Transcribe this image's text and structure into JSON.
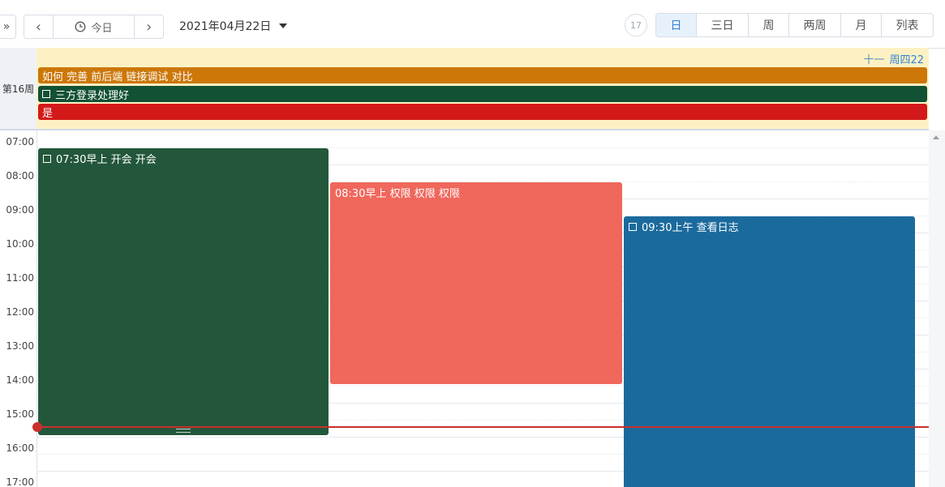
{
  "toolbar": {
    "expand_label": "»",
    "prev_label": "‹",
    "today_label": "今日",
    "next_label": "›",
    "date_label": "2021年04月22日",
    "day_number": "17",
    "views": [
      "日",
      "三日",
      "周",
      "两周",
      "月",
      "列表"
    ],
    "active_view": "日"
  },
  "allday": {
    "week_label": "第16周",
    "lunar": "十一",
    "weekday_date": "周四22",
    "events": [
      {
        "title": "如何 完善 前后端 链接调试 对比",
        "color": "#cc7708",
        "checkbox": false
      },
      {
        "title": "三方登录处理好",
        "color": "#125134",
        "checkbox": true
      },
      {
        "title": "是",
        "color": "#d31919",
        "checkbox": false
      }
    ]
  },
  "timegrid": {
    "hours": [
      "07:00",
      "08:00",
      "09:00",
      "10:00",
      "11:00",
      "12:00",
      "13:00",
      "14:00",
      "15:00",
      "16:00",
      "17:00"
    ],
    "events": [
      {
        "title": "07:30早上 开会 开会",
        "color": "#23573b",
        "checkbox": true
      },
      {
        "title": "08:30早上 权限 权限 权限",
        "color": "#f0675c",
        "checkbox": false
      },
      {
        "title": "09:30上午 查看日志",
        "color": "#1b6a9d",
        "checkbox": true
      }
    ]
  }
}
